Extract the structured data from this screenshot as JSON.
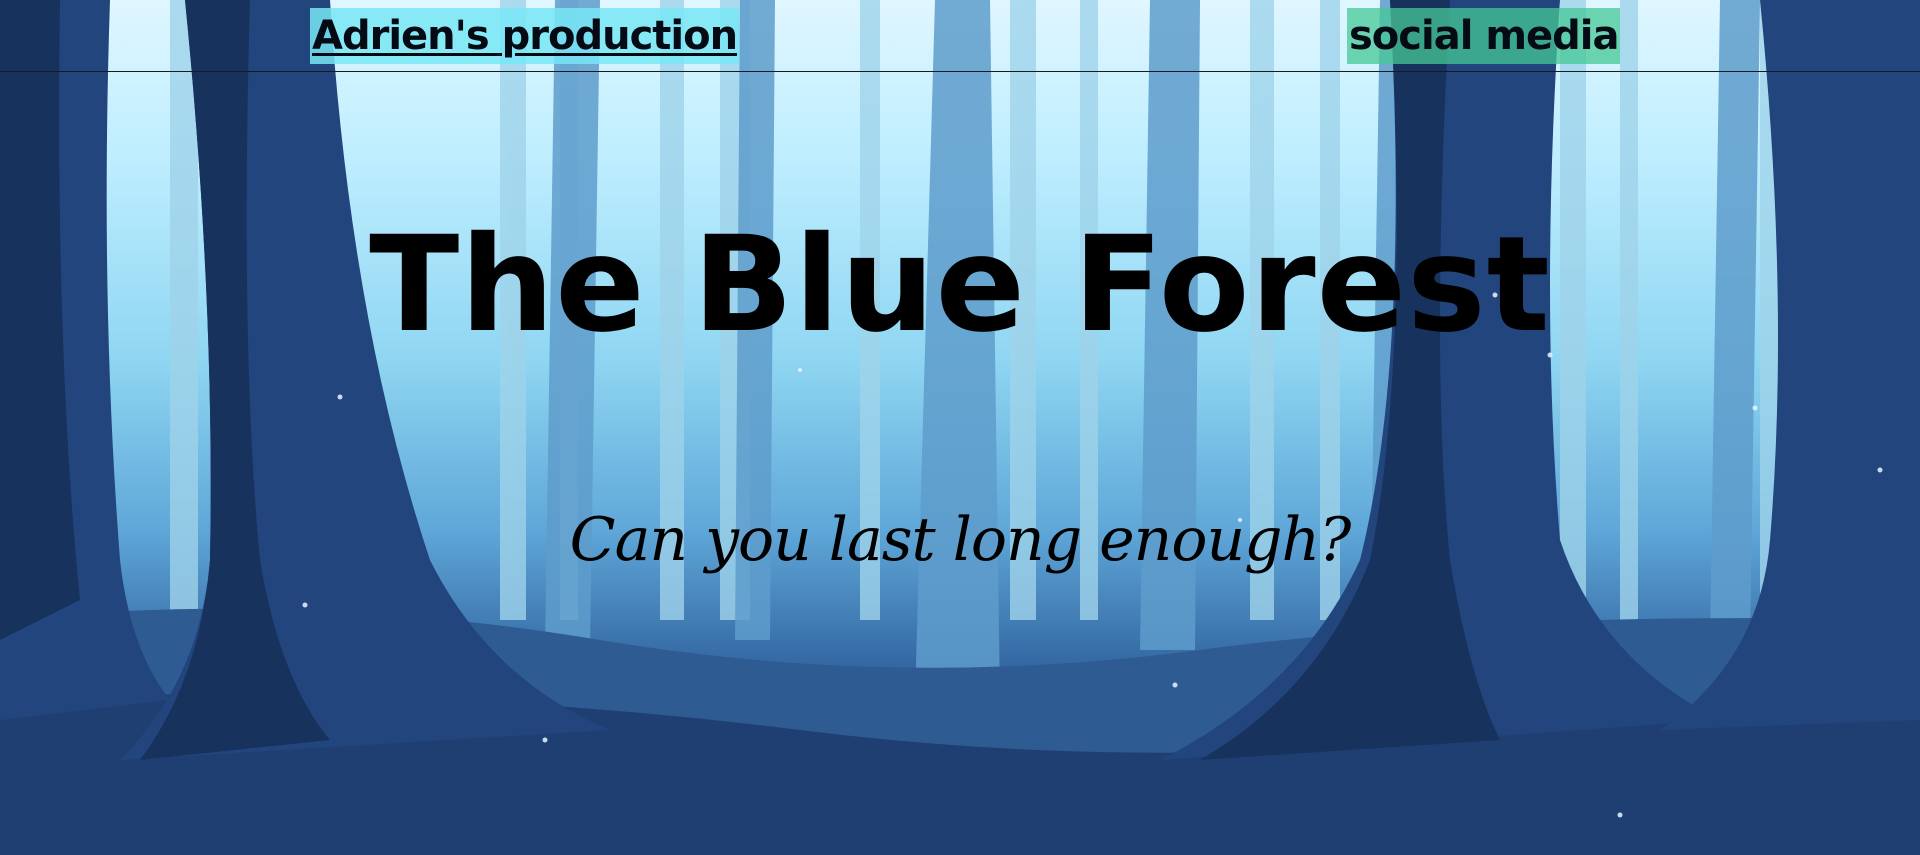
{
  "nav": {
    "home_link": "Adrien's production",
    "social_link": "social media",
    "home_highlight": "#78e6f5",
    "social_highlight": "#46c896"
  },
  "hero": {
    "title": "The Blue Forest",
    "tagline": "Can you last long enough?"
  },
  "background": {
    "description_icon": "forest-illustration",
    "sky_color": "#dff6ff",
    "trunk_color": "#1e3d73"
  }
}
